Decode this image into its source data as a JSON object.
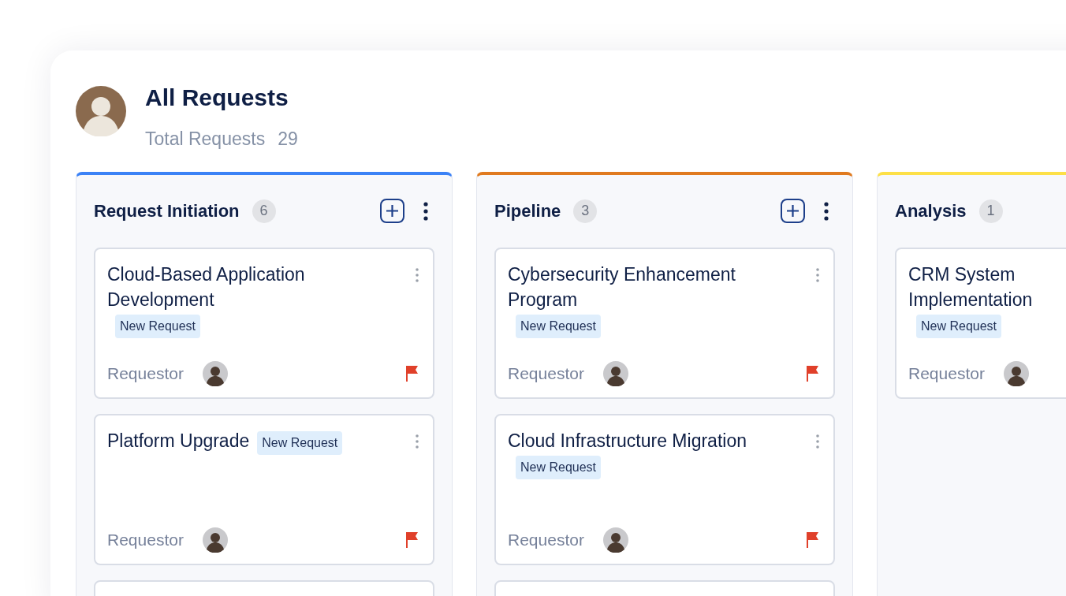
{
  "header": {
    "title": "All Requests",
    "subtitle": "Total Requests",
    "total": "29"
  },
  "columns": [
    {
      "name": "Request Initiation",
      "count": "6",
      "color": "#3b82f6",
      "actions": true,
      "cards": [
        {
          "kind": "request",
          "title": "Cloud-Based Application Development",
          "tag": "New Request",
          "requestor": "Requestor",
          "flagged": true
        },
        {
          "kind": "request",
          "title": "Platform Upgrade",
          "tag": "New Request",
          "requestor": "Requestor",
          "flagged": true
        },
        {
          "kind": "stub"
        }
      ]
    },
    {
      "name": "Pipeline",
      "count": "3",
      "color": "#e07a1f",
      "actions": true,
      "cards": [
        {
          "kind": "request",
          "title": "Cybersecurity Enhancement Program",
          "tag": "New Request",
          "requestor": "Requestor",
          "flagged": true
        },
        {
          "kind": "request",
          "title": "Cloud Infrastructure Migration",
          "tag": "New Request",
          "requestor": "Requestor",
          "flagged": true
        },
        {
          "kind": "stub"
        }
      ]
    },
    {
      "name": "Analysis",
      "count": "1",
      "color": "#fde047",
      "actions": false,
      "cards": [
        {
          "kind": "request",
          "title": "CRM System Implementation",
          "tag": "New Request",
          "requestor": "Requestor",
          "flagged": false
        }
      ]
    }
  ]
}
